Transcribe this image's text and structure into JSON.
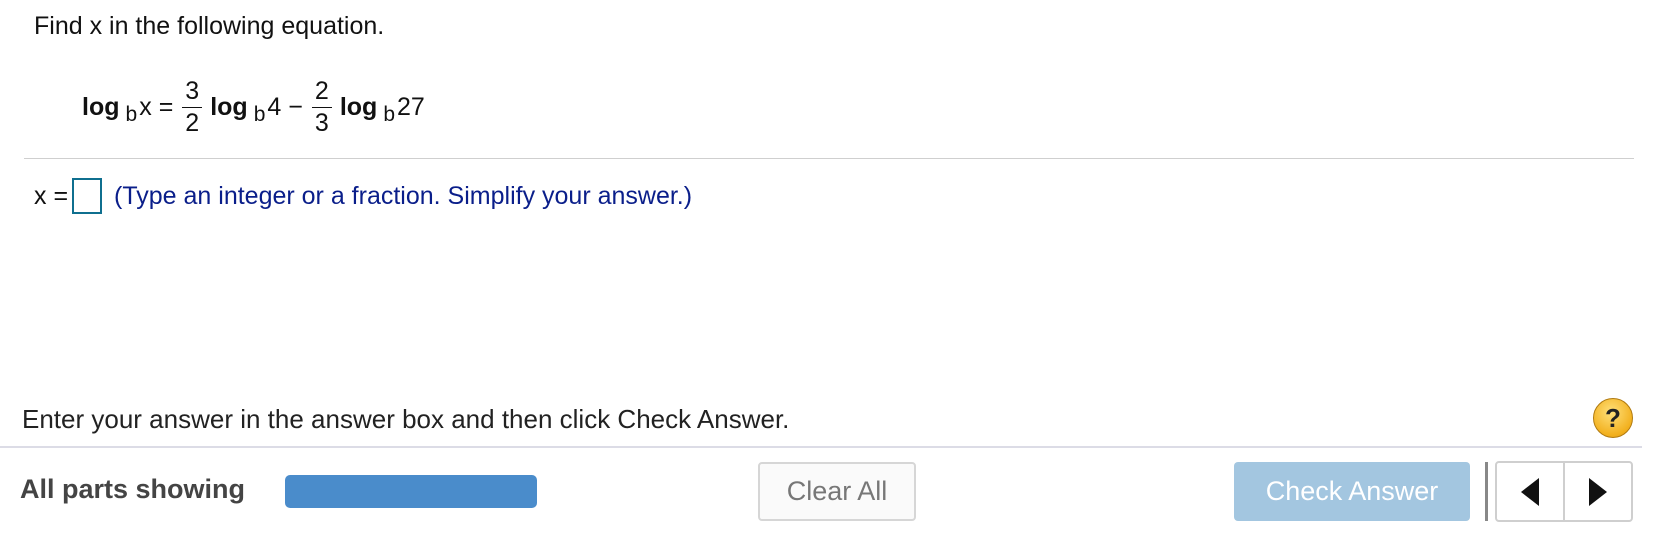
{
  "question": {
    "prompt": "Find x in the following equation."
  },
  "equation": {
    "log": "log",
    "base": "b",
    "lhs_arg": "x",
    "equals": "=",
    "coef1_num": "3",
    "coef1_den": "2",
    "arg1": "4",
    "minus": "−",
    "coef2_num": "2",
    "coef2_den": "3",
    "arg2": "27"
  },
  "answer": {
    "label": "x =",
    "value": "",
    "hint": "(Type an integer or a fraction. Simplify your answer.)"
  },
  "footer": {
    "instructions": "Enter your answer in the answer box and then click Check Answer.",
    "help_label": "?",
    "parts_label": "All parts showing",
    "progress_fraction": 1.0,
    "clear_label": "Clear All",
    "check_label": "Check Answer"
  },
  "colors": {
    "hint_text": "#0a1e8a",
    "progress_fill": "#4a8ccb",
    "check_button_disabled": "#a3c6e0",
    "help_button": "#f2b01e",
    "answer_box_border": "#0f6f8f"
  },
  "icons": {
    "help": "question-mark-icon",
    "previous": "triangle-left-icon",
    "next": "triangle-right-icon"
  }
}
